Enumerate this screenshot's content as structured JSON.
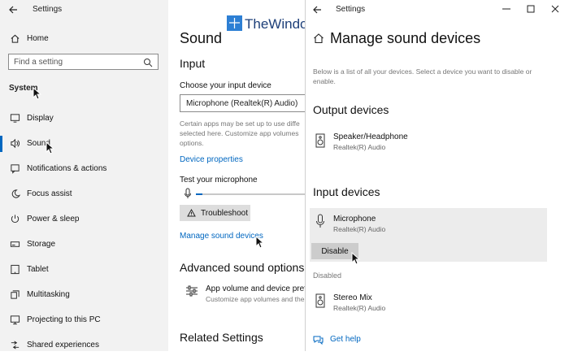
{
  "left_window": {
    "title": "Settings",
    "home_label": "Home",
    "search_placeholder": "Find a setting",
    "section_label": "System",
    "nav_items": [
      {
        "label": "Display",
        "icon": "display-icon"
      },
      {
        "label": "Sound",
        "icon": "speaker-icon"
      },
      {
        "label": "Notifications & actions",
        "icon": "notifications-icon"
      },
      {
        "label": "Focus assist",
        "icon": "moon-icon"
      },
      {
        "label": "Power & sleep",
        "icon": "power-icon"
      },
      {
        "label": "Storage",
        "icon": "storage-icon"
      },
      {
        "label": "Tablet",
        "icon": "tablet-icon"
      },
      {
        "label": "Multitasking",
        "icon": "multitasking-icon"
      },
      {
        "label": "Projecting to this PC",
        "icon": "projecting-icon"
      },
      {
        "label": "Shared experiences",
        "icon": "shared-icon"
      }
    ],
    "selected": "Sound"
  },
  "sound_page": {
    "title": "Sound",
    "input_heading": "Input",
    "choose_label": "Choose your input device",
    "dropdown_value": "Microphone (Realtek(R) Audio)",
    "info_line1": "Certain apps may be set up to use diffe",
    "info_line2": "selected here. Customize app volumes",
    "info_line3": "options.",
    "device_properties": "Device properties",
    "test_label": "Test your microphone",
    "troubleshoot": "Troubleshoot",
    "manage_link": "Manage sound devices",
    "advanced_heading": "Advanced sound options",
    "app_volume_title": "App volume and device prefere",
    "app_volume_sub": "Customize app volumes and the",
    "related_heading": "Related Settings"
  },
  "watermark": "TheWindowsClub",
  "right_window": {
    "title": "Settings",
    "page_title": "Manage sound devices",
    "description_line1": "Below is a list of all your devices. Select a device you want to disable or",
    "description_line2": "enable.",
    "output_heading": "Output devices",
    "output_devices": [
      {
        "name": "Speaker/Headphone",
        "sub": "Realtek(R) Audio"
      }
    ],
    "input_heading": "Input devices",
    "input_devices": [
      {
        "name": "Microphone",
        "sub": "Realtek(R) Audio"
      }
    ],
    "disable_button": "Disable",
    "disabled_heading": "Disabled",
    "disabled_devices": [
      {
        "name": "Stereo Mix",
        "sub": "Realtek(R) Audio"
      }
    ],
    "get_help": "Get help"
  },
  "colors": {
    "accent": "#0067c0",
    "nav_bg": "#f2f2f2",
    "selected_block": "#ececec",
    "button": "#dddddd"
  }
}
